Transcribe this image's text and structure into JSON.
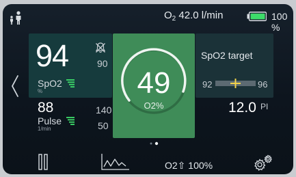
{
  "status_bar": {
    "patient_icon": "adult-child-icon",
    "o2_symbol": "O",
    "o2_subscript": "2",
    "o2_flow": "42.0 l/min",
    "battery_icon": "battery-icon",
    "battery_level": 1.0,
    "battery_percent": "100 %"
  },
  "spo2": {
    "value": "94",
    "alarm_icon": "alarm-off-icon",
    "limit": "90",
    "label": "SpO2",
    "unit": "%",
    "signal_icon": "signal-quality-icon"
  },
  "pulse": {
    "value": "88",
    "label": "Pulse",
    "unit": "1/min",
    "high_limit": "140",
    "low_limit": "50",
    "signal_icon": "signal-quality-icon"
  },
  "o2_tile": {
    "value": "49",
    "label": "O2%",
    "gauge_icon": "circular-gauge-icon"
  },
  "spo2_target": {
    "title": "SpO2 target",
    "low": "92",
    "high": "96",
    "slider_icon": "target-range-slider-icon"
  },
  "pi": {
    "value": "12.0",
    "label": "PI"
  },
  "navigation": {
    "left_icon": "chevron-left-icon",
    "page_dots_icon": "page-indicator-icon",
    "page_count": 2,
    "active_page": 2
  },
  "toolbar": {
    "pause_icon": "pause-icon",
    "trend_icon": "trend-chart-icon",
    "o2_boost_label": "O2⇧ 100%",
    "settings_icon": "settings-gears-icon"
  },
  "colors": {
    "background": "#111b25",
    "spo2_tile": "#163b3d",
    "o2_tile": "#3f8c58",
    "target_tile": "#1b3238",
    "accent_green": "#3ddc6a",
    "slider_marker": "#f3d34a"
  }
}
